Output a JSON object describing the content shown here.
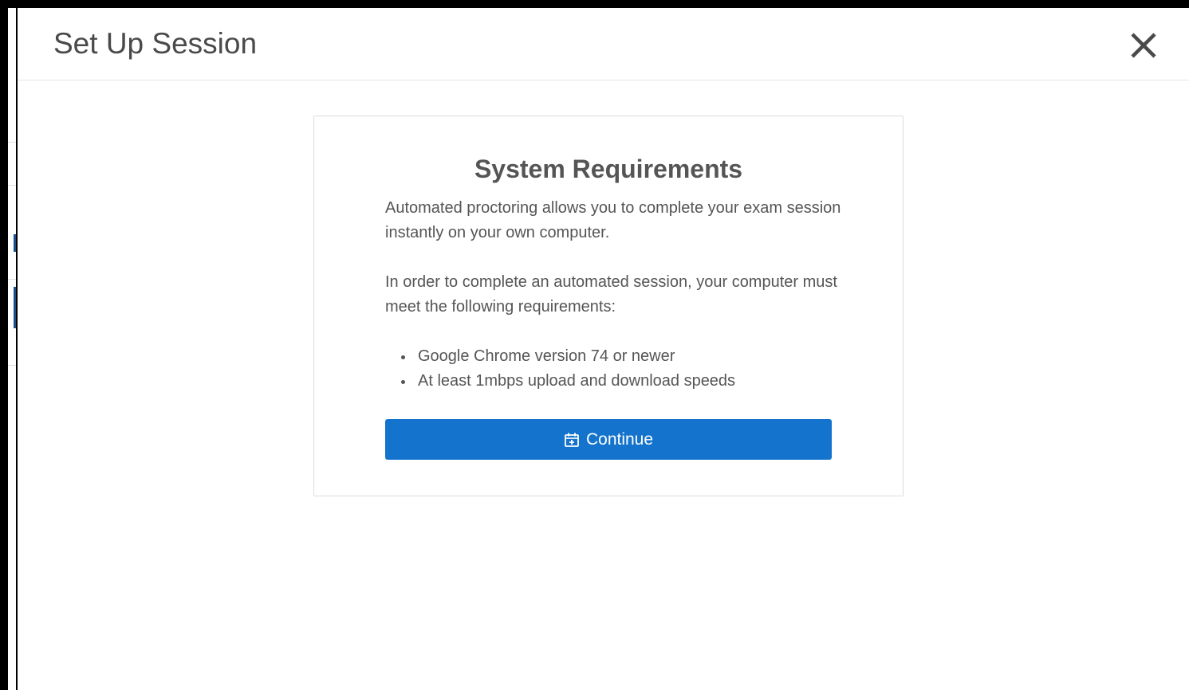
{
  "modal": {
    "title": "Set Up Session",
    "close_icon": "close-icon"
  },
  "card": {
    "title": "System Requirements",
    "paragraphs": [
      "Automated proctoring allows you to complete your exam session instantly on your own computer.",
      "In order to complete an automated session, your computer must meet the following requirements:"
    ],
    "requirements": [
      "Google Chrome version 74 or newer",
      "At least 1mbps upload and download speeds"
    ],
    "continue_label": "Continue",
    "continue_icon": "calendar-plus-icon"
  },
  "colors": {
    "button": "#1473cc",
    "text": "#555555",
    "title": "#4a4a4a"
  }
}
